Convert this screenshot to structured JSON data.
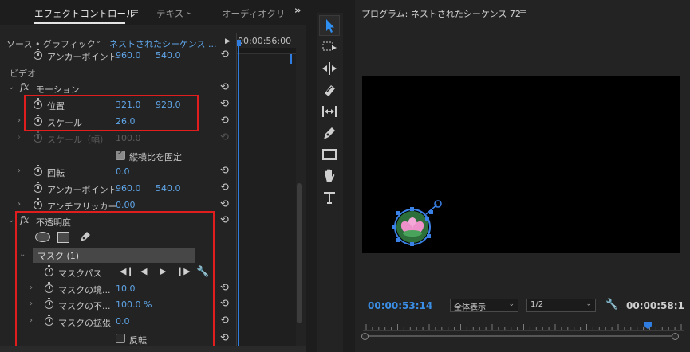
{
  "effect_controls": {
    "tabs": [
      {
        "label": "エフェクトコントロール",
        "active": true
      },
      {
        "label": "テキスト",
        "active": false
      },
      {
        "label": "オーディオクリ",
        "active": false
      }
    ],
    "menu_icon": "≡",
    "more_icon": "»",
    "source_label": "ソース • グラフィック",
    "sequence_label": "ネストされたシーケンス ...",
    "timecode": "00:00:56:00",
    "section_video": "ビデオ",
    "rows": {
      "anchor_top": {
        "label": "アンカーポイント",
        "x": "960.0",
        "y": "540.0"
      },
      "motion": {
        "label": "モーション"
      },
      "position": {
        "label": "位置",
        "x": "321.0",
        "y": "928.0"
      },
      "scale": {
        "label": "スケール",
        "value": "26.0"
      },
      "scale_width": {
        "label": "スケール（幅）",
        "value": "100.0"
      },
      "uniform_scale": {
        "label": "縦横比を固定",
        "checked": true
      },
      "rotation": {
        "label": "回転",
        "value": "0.0"
      },
      "anchor": {
        "label": "アンカーポイント",
        "x": "960.0",
        "y": "540.0"
      },
      "anti_flicker": {
        "label": "アンチフリッカー",
        "value": "0.00"
      },
      "opacity": {
        "label": "不透明度"
      },
      "mask": {
        "label": "マスク (1)"
      },
      "mask_path": {
        "label": "マスクパス"
      },
      "mask_feather": {
        "label": "マスクの境...",
        "value": "10.0"
      },
      "mask_opacity": {
        "label": "マスクの不...",
        "value": "100.0 %"
      },
      "mask_expansion": {
        "label": "マスクの拡張",
        "value": "0.0"
      },
      "inverted": {
        "label": "反転",
        "checked": false
      }
    }
  },
  "program_monitor": {
    "title": "プログラム: ネストされたシーケンス 72",
    "menu_icon": "≡",
    "current_time": "00:00:53:14",
    "fit_option": "全体表示",
    "resolution": "1/2",
    "duration": "00:00:58:1"
  },
  "colors": {
    "accent_blue": "#2f7de1",
    "value_blue": "#5fa5e8",
    "highlight_red": "#e11d1d",
    "panel_bg": "#232323"
  }
}
